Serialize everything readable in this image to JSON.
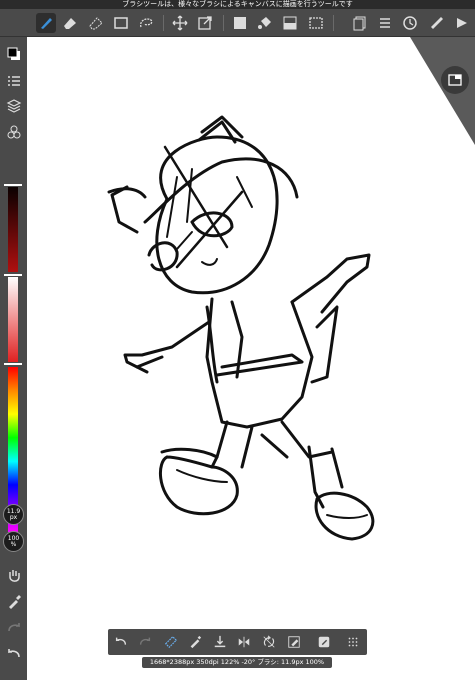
{
  "hint_text": "ブラシツールは、様々なブラシによるキャンバスに描画を行うツールです",
  "toolbar": {
    "icons": [
      "brush-icon",
      "eraser-icon",
      "soft-eraser-icon",
      "select-rect-icon",
      "lasso-icon",
      "move-icon",
      "transform-icon",
      "fill-gray-icon",
      "fill-icon",
      "layer-fill-icon",
      "rect-icon",
      "pages-icon",
      "list-icon",
      "layers-icon",
      "ruler-icon"
    ]
  },
  "sidebar": {
    "brush_size_value": "11.9",
    "brush_size_unit": "px",
    "opacity_value": "100",
    "opacity_unit": "%"
  },
  "status_text": "1668*2388px 350dpi 122% -20° ブラシ: 11.9px 100%",
  "colors": {
    "ui_dark": "#4a4a4a",
    "canvas": "#ffffff",
    "active_tool": "#3a8fd8"
  }
}
